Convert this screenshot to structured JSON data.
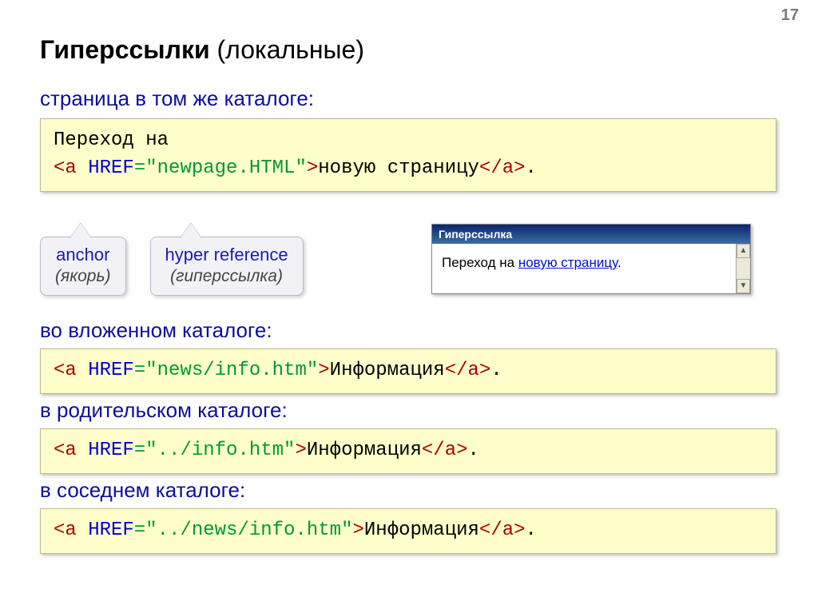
{
  "page_number": "17",
  "title_bold": "Гиперссылки",
  "title_rest": " (локальные)",
  "sec1": {
    "heading": "страница в том же каталоге:",
    "code_line1": "Переход на",
    "code_open_tag": "<a",
    "code_attr": " HREF",
    "code_val": "=\"newpage.HTML\"",
    "code_close_open": ">",
    "code_text": "новую страницу",
    "code_close_tag": "</a>",
    "code_after": "."
  },
  "callout_anchor_en": "anchor",
  "callout_anchor_ru": "(якорь)",
  "callout_href_en": "hyper reference",
  "callout_href_ru": "(гиперссылка)",
  "preview": {
    "titlebar": "Гиперссылка",
    "text_before": "Переход на ",
    "link_text": "новую страницу",
    "text_after": "."
  },
  "sec2": {
    "heading": "во вложенном каталоге:",
    "open": "<a",
    "attr": " HREF",
    "val": "=\"news/info.htm\"",
    "gt": ">",
    "text": "Информация",
    "close": "</a>",
    "after": "."
  },
  "sec3": {
    "heading": "в родительском каталоге:",
    "open": "<a",
    "attr": " HREF",
    "val": "=\"../info.htm\"",
    "gt": ">",
    "text": "Информация",
    "close": "</a>",
    "after": "."
  },
  "sec4": {
    "heading": "в соседнем каталоге:",
    "open": "<a",
    "attr": " HREF",
    "val": "=\"../news/info.htm\"",
    "gt": ">",
    "text": "Информация",
    "close": "</a>",
    "after": "."
  }
}
